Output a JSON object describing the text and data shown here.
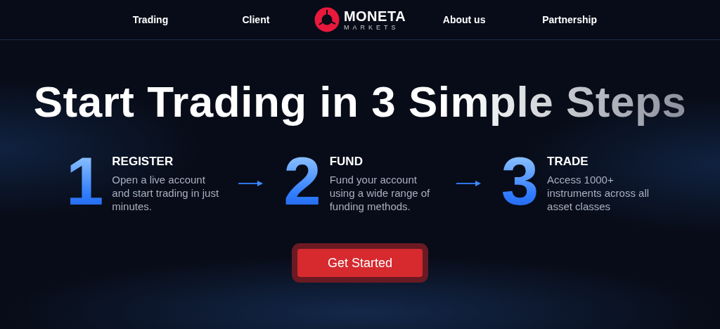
{
  "nav": {
    "items": [
      {
        "label": "Trading"
      },
      {
        "label": "Client"
      }
    ],
    "logo": {
      "name": "MONETA",
      "tagline": "MARKETS"
    },
    "items_right": [
      {
        "label": "About us"
      },
      {
        "label": "Partnership"
      }
    ]
  },
  "hero": {
    "title": "Start Trading in 3 Simple Steps",
    "steps": [
      {
        "number": "1",
        "title": "REGISTER",
        "text": "Open a live account and start trading in just minutes."
      },
      {
        "number": "2",
        "title": "FUND",
        "text": "Fund your account using a wide range of funding methods."
      },
      {
        "number": "3",
        "title": "TRADE",
        "text": "Access 1000+ instruments across all asset classes"
      }
    ],
    "button": "Get Started"
  }
}
